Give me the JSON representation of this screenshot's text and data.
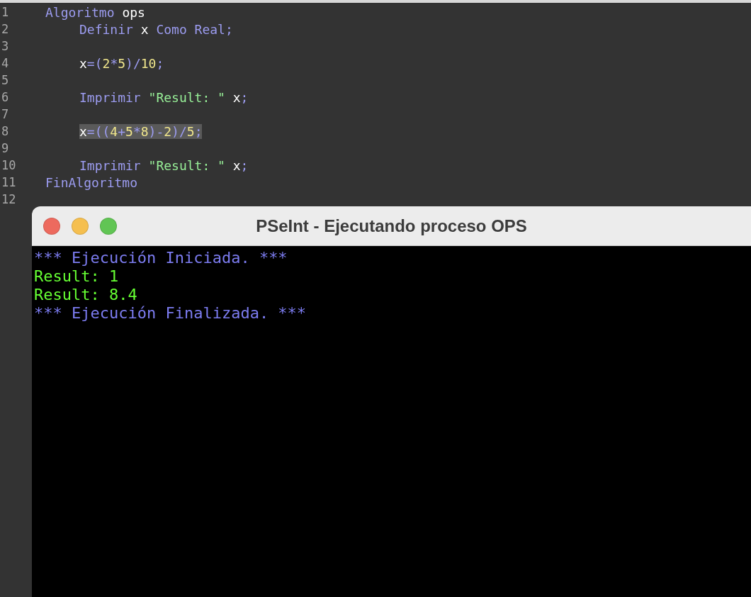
{
  "editor": {
    "lines": [
      {
        "number": "1",
        "tokens": [
          {
            "text": "Algoritmo",
            "kind": "keyword"
          },
          {
            "text": " ops",
            "kind": "identifier"
          }
        ],
        "children": [
          {
            "number": "2",
            "tokens": [
              {
                "text": "Definir",
                "kind": "keyword"
              },
              {
                "text": " x ",
                "kind": "identifier"
              },
              {
                "text": "Como Real",
                "kind": "keyword"
              },
              {
                "text": ";",
                "kind": "operator"
              }
            ]
          },
          {
            "number": "3"
          },
          {
            "number": "4",
            "tokens": [
              {
                "text": "x",
                "kind": "identifier"
              },
              {
                "text": "=(",
                "kind": "operator"
              },
              {
                "text": "2",
                "kind": "number"
              },
              {
                "text": "*",
                "kind": "operator"
              },
              {
                "text": "5",
                "kind": "number"
              },
              {
                "text": ")/",
                "kind": "operator"
              },
              {
                "text": "10",
                "kind": "number"
              },
              {
                "text": ";",
                "kind": "operator"
              }
            ]
          },
          {
            "number": "5"
          },
          {
            "number": "6",
            "tokens": [
              {
                "text": "Imprimir ",
                "kind": "keyword"
              },
              {
                "text": "\"Result: \"",
                "kind": "string"
              },
              {
                "text": " x",
                "kind": "identifier"
              },
              {
                "text": ";",
                "kind": "operator"
              }
            ]
          },
          {
            "number": "7"
          },
          {
            "number": "8",
            "tokens": [
              {
                "text": "x",
                "kind": "identifier"
              },
              {
                "text": "=((",
                "kind": "operator"
              },
              {
                "text": "4",
                "kind": "number"
              },
              {
                "text": "+",
                "kind": "operator"
              },
              {
                "text": "5",
                "kind": "number"
              },
              {
                "text": "*",
                "kind": "operator"
              },
              {
                "text": "8",
                "kind": "number"
              },
              {
                "text": ")-",
                "kind": "operator"
              },
              {
                "text": "2",
                "kind": "number"
              },
              {
                "text": ")/",
                "kind": "operator"
              },
              {
                "text": "5",
                "kind": "number"
              },
              {
                "text": ";",
                "kind": "operator"
              }
            ],
            "highlighted": true
          },
          {
            "number": "9"
          },
          {
            "number": "10",
            "tokens": [
              {
                "text": "Imprimir ",
                "kind": "keyword"
              },
              {
                "text": "\"Result: \"",
                "kind": "string"
              },
              {
                "text": " x",
                "kind": "identifier"
              },
              {
                "text": ";",
                "kind": "operator"
              }
            ]
          }
        ]
      },
      {
        "number": "11",
        "tokens": [
          {
            "text": "FinAlgoritmo",
            "kind": "keyword"
          }
        ]
      },
      {
        "number": "12"
      }
    ]
  },
  "console_window": {
    "title": "PSeInt - Ejecutando proceso OPS",
    "lines": [
      {
        "text": "*** Ejecución Iniciada. ***",
        "kind": "status"
      },
      {
        "text": "Result: 1",
        "kind": "output"
      },
      {
        "text": "Result: 8.4",
        "kind": "output"
      },
      {
        "text": "*** Ejecución Finalizada. ***",
        "kind": "status"
      }
    ]
  }
}
